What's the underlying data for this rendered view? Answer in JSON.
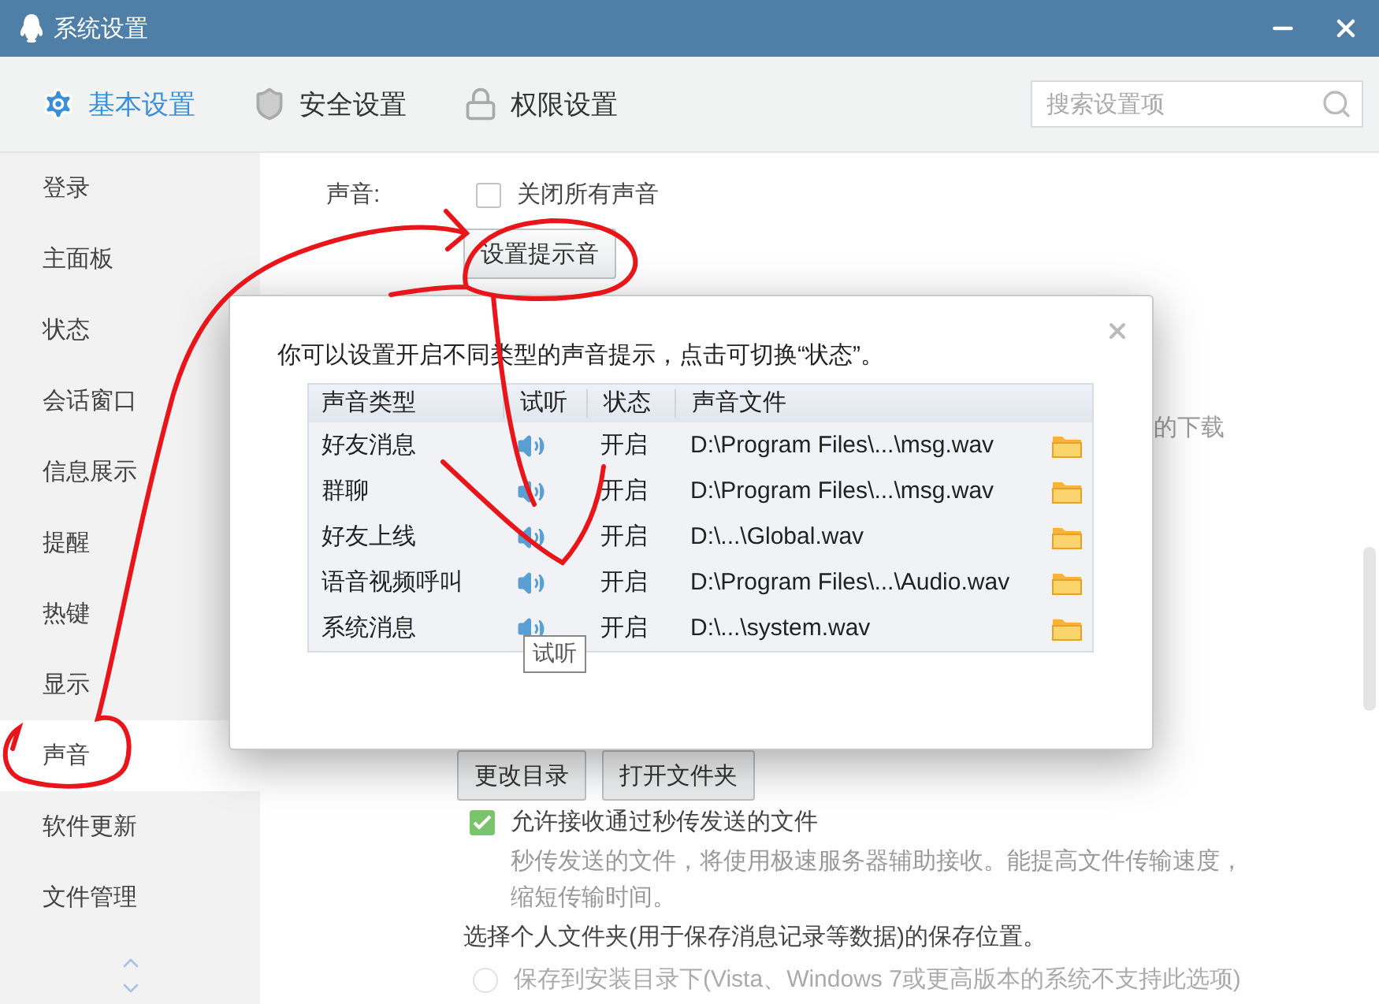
{
  "window": {
    "title": "系统设置"
  },
  "tabs": [
    {
      "label": "基本设置",
      "selected": true
    },
    {
      "label": "安全设置",
      "selected": false
    },
    {
      "label": "权限设置",
      "selected": false
    }
  ],
  "search": {
    "placeholder": "搜索设置项"
  },
  "sidebar": {
    "items": [
      {
        "label": "登录",
        "selected": false
      },
      {
        "label": "主面板",
        "selected": false
      },
      {
        "label": "状态",
        "selected": false
      },
      {
        "label": "会话窗口",
        "selected": false
      },
      {
        "label": "信息展示",
        "selected": false
      },
      {
        "label": "提醒",
        "selected": false
      },
      {
        "label": "热键",
        "selected": false
      },
      {
        "label": "显示",
        "selected": false
      },
      {
        "label": "声音",
        "selected": true
      },
      {
        "label": "软件更新",
        "selected": false
      },
      {
        "label": "文件管理",
        "selected": false
      }
    ]
  },
  "content": {
    "sound_label": "声音:",
    "mute_all": {
      "label": "关闭所有声音",
      "checked": false
    },
    "set_sounds_button": "设置提示音",
    "partial_text": "的下载",
    "folder_buttons": [
      "更改目录",
      "打开文件夹"
    ],
    "fast_transfer": {
      "label": "允许接收通过秒传发送的文件",
      "checked": true
    },
    "fast_transfer_note": "秒传发送的文件，将使用极速服务器辅助接收。能提高文件传输速度，缩短传输时间。",
    "folder_heading": "选择个人文件夹(用于保存消息记录等数据)的保存位置。",
    "install_dir_option": {
      "label": "保存到安装目录下(Vista、Windows 7或更高版本的系统不支持此选项)",
      "selected": false,
      "disabled": true
    }
  },
  "dialog": {
    "message": "你可以设置开启不同类型的声音提示，点击可切换“状态”。",
    "table": {
      "columns": [
        "声音类型",
        "试听",
        "状态",
        "声音文件"
      ],
      "rows": [
        {
          "type": "好友消息",
          "status": "开启",
          "file": "D:\\Program Files\\...\\msg.wav"
        },
        {
          "type": "群聊",
          "status": "开启",
          "file": "D:\\Program Files\\...\\msg.wav"
        },
        {
          "type": "好友上线",
          "status": "开启",
          "file": "D:\\...\\Global.wav"
        },
        {
          "type": "语音视频呼叫",
          "status": "开启",
          "file": "D:\\Program Files\\...\\Audio.wav"
        },
        {
          "type": "系统消息",
          "status": "开启",
          "file": "D:\\...\\system.wav"
        }
      ]
    },
    "tooltip": "试听"
  }
}
